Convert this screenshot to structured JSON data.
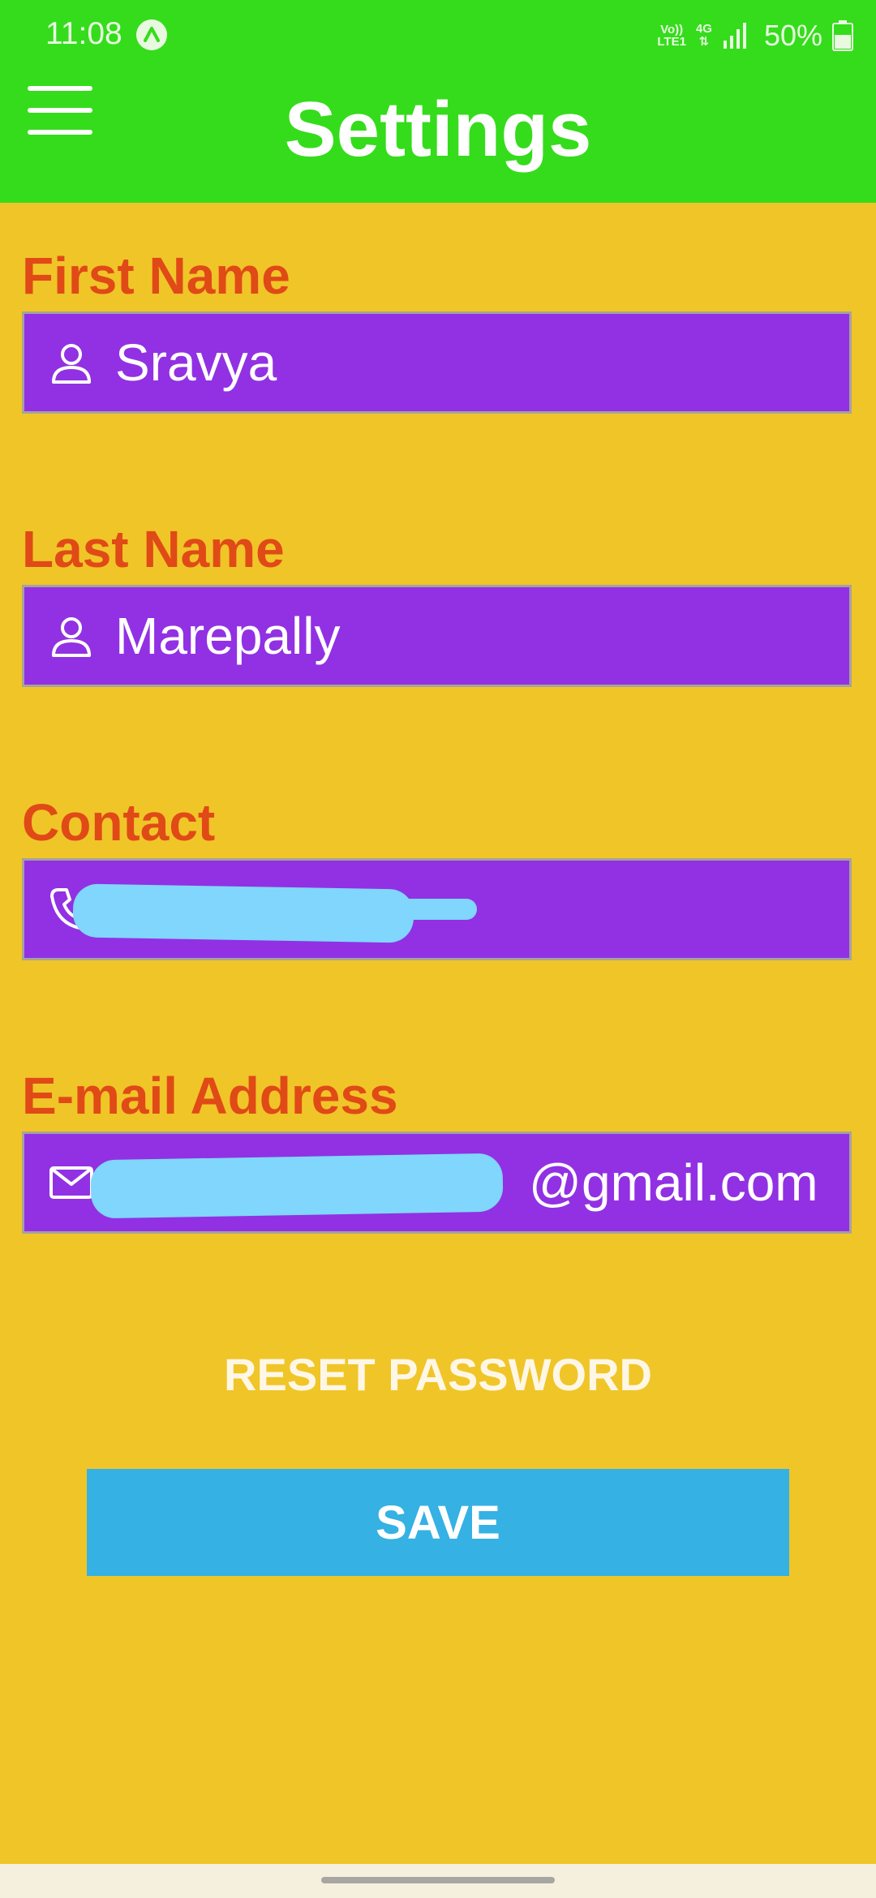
{
  "status_bar": {
    "time": "11:08",
    "network_top": "Vo))",
    "network_bottom": "LTE1",
    "network_type": "4G",
    "battery": "50%"
  },
  "header": {
    "title": "Settings",
    "background_color": "#35dc1c"
  },
  "form": {
    "first_name": {
      "label": "First Name",
      "value": "Sravya",
      "icon": "person-icon"
    },
    "last_name": {
      "label": "Last Name",
      "value": "Marepally",
      "icon": "person-icon"
    },
    "contact": {
      "label": "Contact",
      "value": "",
      "icon": "phone-icon"
    },
    "email": {
      "label": "E-mail Address",
      "value_suffix": "@gmail.com",
      "icon": "mail-icon"
    }
  },
  "actions": {
    "reset_password": "RESET PASSWORD",
    "save": "SAVE"
  },
  "colors": {
    "background": "#f0c528",
    "label": "#e04a17",
    "field": "#9131e3",
    "save_button": "#35b1e3",
    "redaction": "#80d6fc"
  }
}
